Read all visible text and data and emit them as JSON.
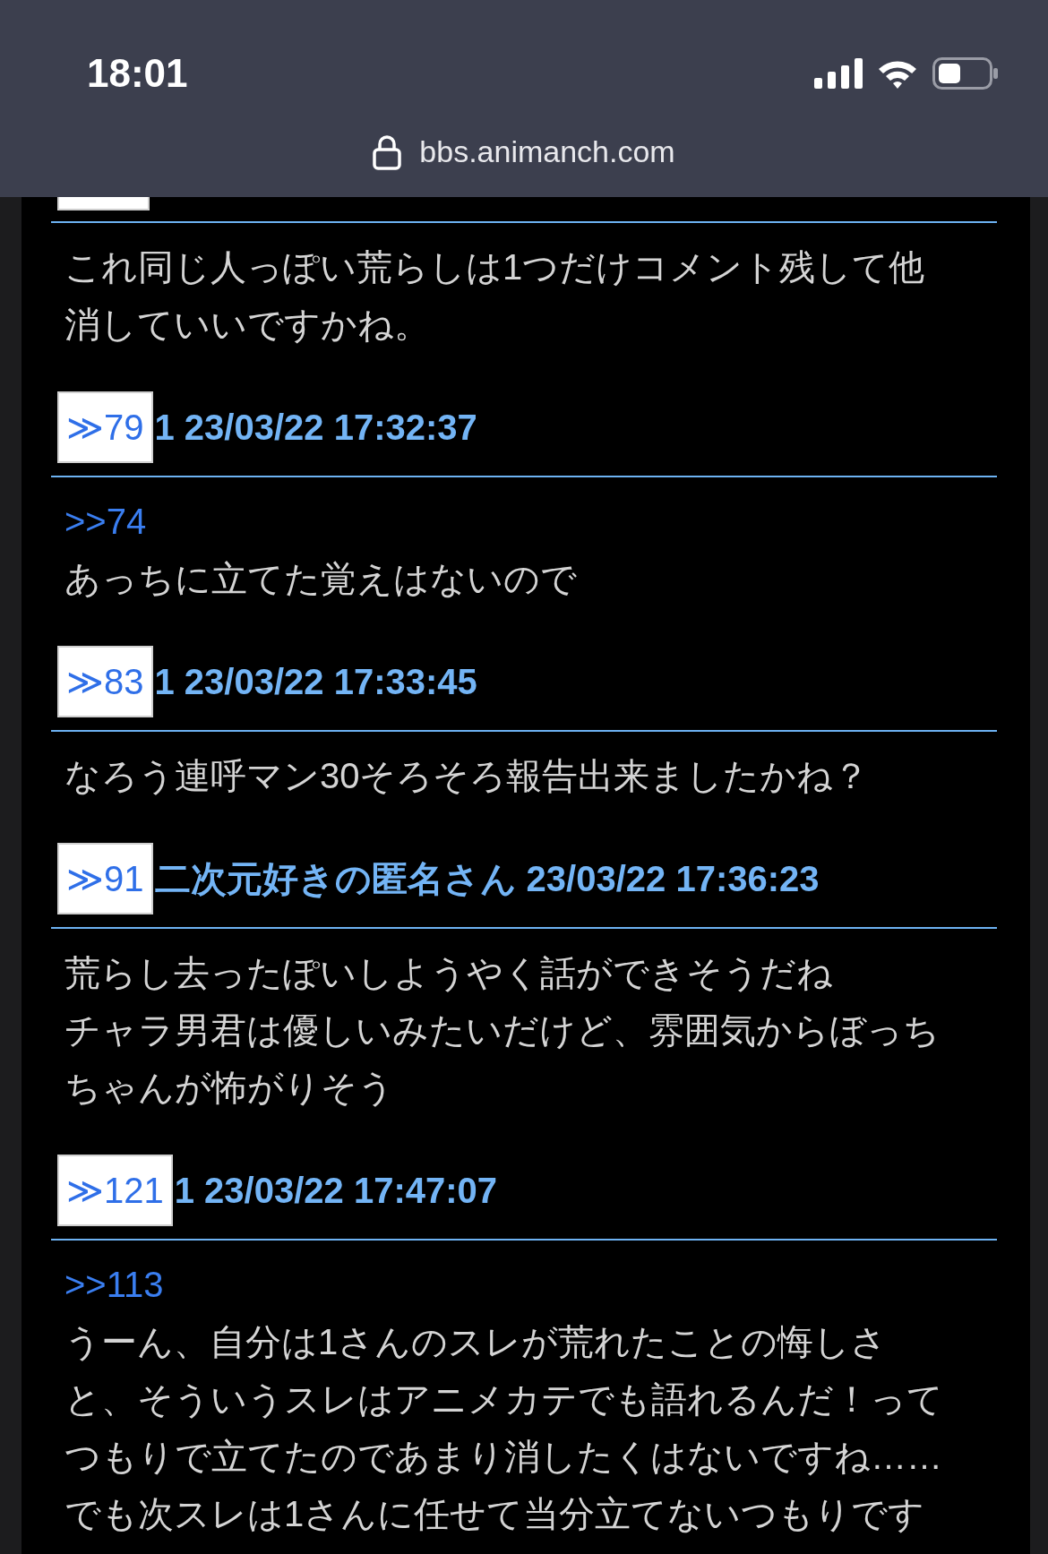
{
  "status_bar": {
    "time": "18:01"
  },
  "address_bar": {
    "url": "bbs.animanch.com"
  },
  "posts": [
    {
      "header_cut": true,
      "lines": [
        "これ同じ人っぽい荒らしは1つだけコメント残して他",
        "消していいですかね。"
      ]
    },
    {
      "number": "≫79",
      "meta": "1 23/03/22 17:32:37",
      "reply_to": ">>74",
      "lines": [
        "あっちに立てた覚えはないので"
      ]
    },
    {
      "number": "≫83",
      "meta": "1 23/03/22 17:33:45",
      "lines": [
        "なろう連呼マン30そろそろ報告出来ましたかね？"
      ]
    },
    {
      "number": "≫91",
      "meta": "二次元好きの匿名さん 23/03/22 17:36:23",
      "lines": [
        "荒らし去ったぽいしようやく話ができそうだね",
        "チャラ男君は優しいみたいだけど、雰囲気からぼっち",
        "ちゃんが怖がりそう"
      ]
    },
    {
      "number": "≫121",
      "meta": "1 23/03/22 17:47:07",
      "reply_to": ">>113",
      "lines": [
        "うーん、自分は1さんのスレが荒れたことの悔しさ",
        "と、そういうスレはアニメカテでも語れるんだ！って",
        "つもりで立てたのであまり消したくはないですね……",
        "でも次スレは1さんに任せて当分立てないつもりです"
      ]
    }
  ]
}
